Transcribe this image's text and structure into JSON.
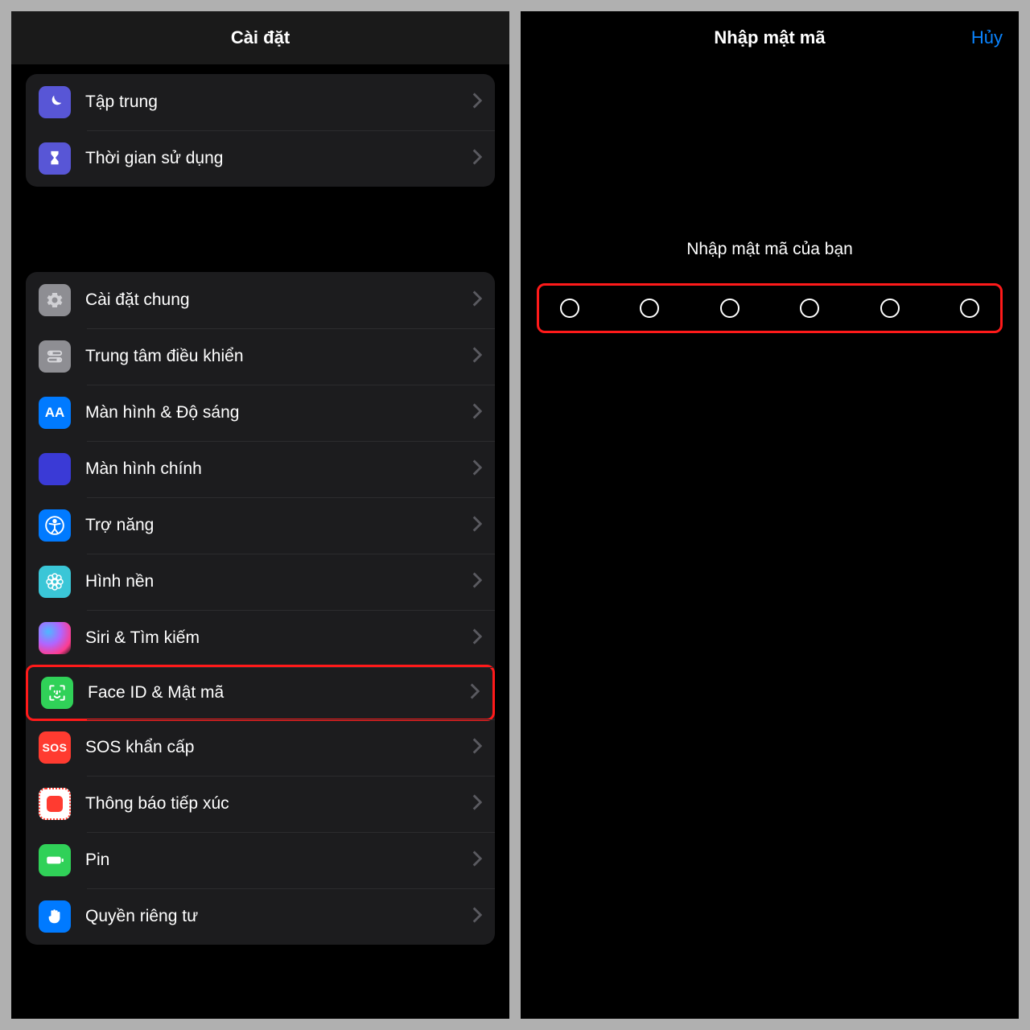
{
  "left": {
    "title": "Cài đặt",
    "group1": [
      {
        "label": "Tập trung"
      },
      {
        "label": "Thời gian sử dụng"
      }
    ],
    "group2": [
      {
        "label": "Cài đặt chung"
      },
      {
        "label": "Trung tâm điều khiển"
      },
      {
        "label": "Màn hình & Độ sáng"
      },
      {
        "label": "Màn hình chính"
      },
      {
        "label": "Trợ năng"
      },
      {
        "label": "Hình nền"
      },
      {
        "label": "Siri & Tìm kiếm"
      },
      {
        "label": "Face ID & Mật mã",
        "highlighted": true
      },
      {
        "label": "SOS khẩn cấp"
      },
      {
        "label": "Thông báo tiếp xúc"
      },
      {
        "label": "Pin"
      },
      {
        "label": "Quyền riêng tư"
      }
    ]
  },
  "right": {
    "title": "Nhập mật mã",
    "cancel": "Hủy",
    "prompt": "Nhập mật mã của bạn",
    "digit_count": 6
  },
  "icons": {
    "sos": "SOS",
    "aa": "AA"
  }
}
